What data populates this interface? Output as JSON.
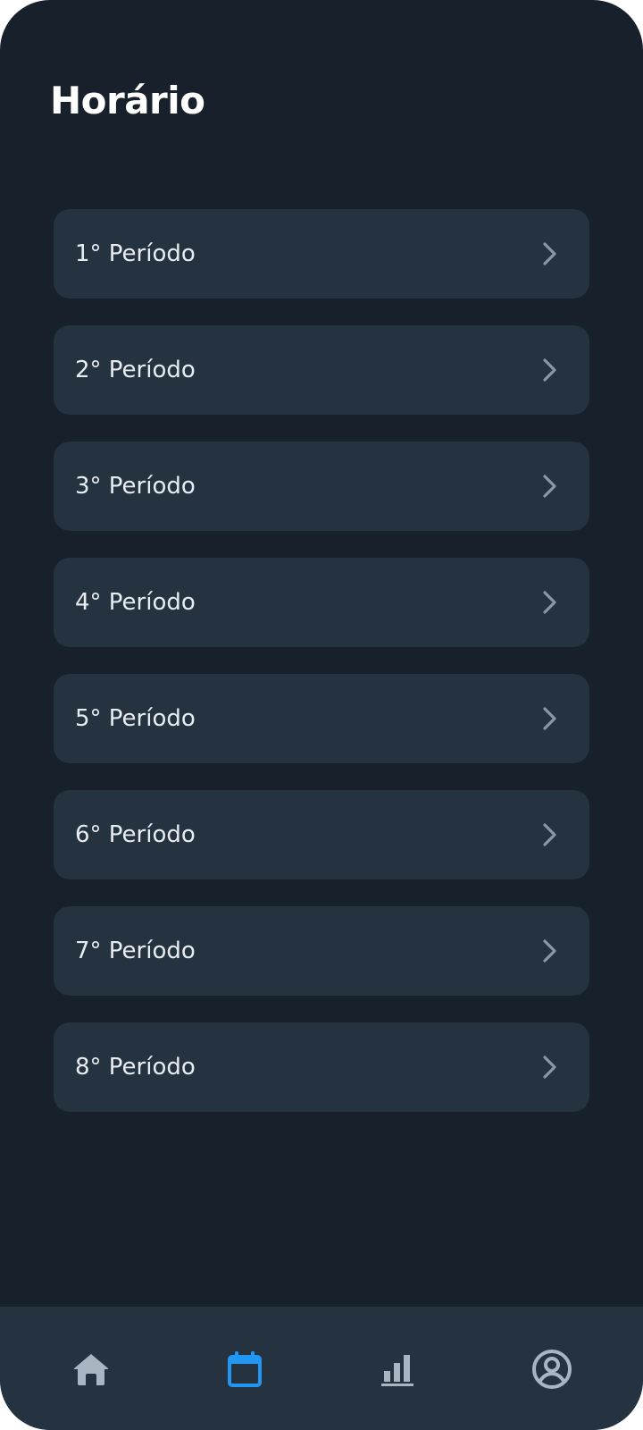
{
  "header": {
    "title": "Horário"
  },
  "periods": [
    {
      "label": "1° Período"
    },
    {
      "label": "2° Período"
    },
    {
      "label": "3° Período"
    },
    {
      "label": "4° Período"
    },
    {
      "label": "5° Período"
    },
    {
      "label": "6° Período"
    },
    {
      "label": "7° Período"
    },
    {
      "label": "8° Período"
    }
  ],
  "bottom_nav": {
    "items": [
      {
        "icon": "home-icon",
        "active": false
      },
      {
        "icon": "calendar-icon",
        "active": true
      },
      {
        "icon": "bar-chart-icon",
        "active": false
      },
      {
        "icon": "user-circle-icon",
        "active": false
      }
    ]
  },
  "colors": {
    "background": "#18202b",
    "card": "#253341",
    "accent": "#2196f3",
    "icon_inactive": "#a9b6c2",
    "chevron": "#8a97a4",
    "text": "#e8edf2"
  }
}
